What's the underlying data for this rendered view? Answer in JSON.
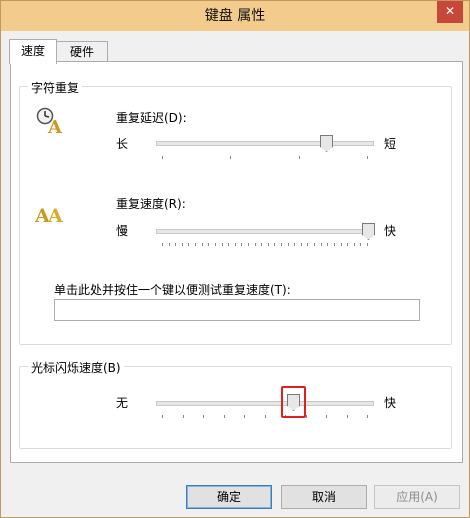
{
  "window": {
    "title": "键盘 属性",
    "close_glyph": "✕",
    "titlebar_color": "#f2cb8d"
  },
  "tabs": [
    {
      "label": "速度",
      "active": true
    },
    {
      "label": "硬件",
      "active": false
    }
  ],
  "char_repeat": {
    "legend": "字符重复",
    "delay": {
      "label": "重复延迟(D):",
      "left": "长",
      "right": "短",
      "value": 0.8,
      "icon": "clock-letter-icon"
    },
    "rate": {
      "label": "重复速度(R):",
      "left": "慢",
      "right": "快",
      "value": 1.0,
      "icon": "double-letter-icon"
    },
    "test": {
      "label": "单击此处并按住一个键以便测试重复速度(T):",
      "value": ""
    }
  },
  "cursor_blink": {
    "legend": "光标闪烁速度(B)",
    "left": "无",
    "right": "快",
    "value": 0.64,
    "highlight_color": "#e02020"
  },
  "buttons": {
    "ok": "确定",
    "cancel": "取消",
    "apply": "应用(A)"
  }
}
